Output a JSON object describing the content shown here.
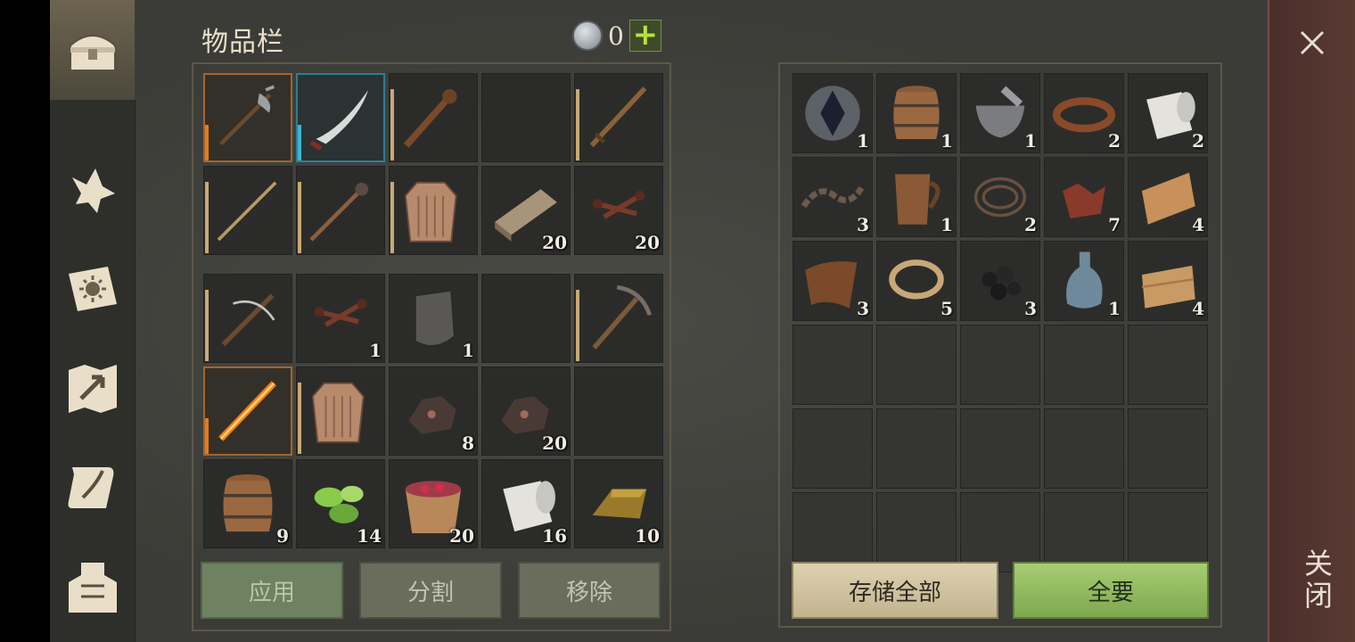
{
  "inventory": {
    "title": "物品栏",
    "coins": "0",
    "plus": "+"
  },
  "left_grid_top": [
    {
      "icon": "halberd-icon",
      "qty": "",
      "style": "orange"
    },
    {
      "icon": "scimitar-icon",
      "qty": "",
      "style": "blue"
    },
    {
      "icon": "spiked-club-icon",
      "qty": "",
      "style": ""
    },
    {
      "icon": "",
      "qty": "",
      "style": ""
    },
    {
      "icon": "sword-icon",
      "qty": "",
      "style": ""
    },
    {
      "icon": "spear-icon",
      "qty": "",
      "style": ""
    },
    {
      "icon": "mace-spear-icon",
      "qty": "",
      "style": ""
    },
    {
      "icon": "chainmail-icon",
      "qty": "",
      "style": ""
    },
    {
      "icon": "plank-icon",
      "qty": "20",
      "style": ""
    },
    {
      "icon": "nails-icon",
      "qty": "20",
      "style": ""
    }
  ],
  "left_grid_bottom": [
    {
      "icon": "crossbow-icon",
      "qty": "",
      "style": ""
    },
    {
      "icon": "nails-icon",
      "qty": "1",
      "style": ""
    },
    {
      "icon": "iron-plate-icon",
      "qty": "1",
      "style": ""
    },
    {
      "icon": "",
      "qty": "",
      "style": ""
    },
    {
      "icon": "pickaxe-icon",
      "qty": "",
      "style": ""
    },
    {
      "icon": "flame-sword-icon",
      "qty": "",
      "style": "orange"
    },
    {
      "icon": "chainmail-icon",
      "qty": "",
      "style": ""
    },
    {
      "icon": "ore-icon",
      "qty": "8",
      "style": ""
    },
    {
      "icon": "ore-icon",
      "qty": "20",
      "style": ""
    },
    {
      "icon": "",
      "qty": "",
      "style": ""
    },
    {
      "icon": "barrel-icon",
      "qty": "9",
      "style": ""
    },
    {
      "icon": "cactus-slices-icon",
      "qty": "14",
      "style": ""
    },
    {
      "icon": "berry-bucket-icon",
      "qty": "20",
      "style": ""
    },
    {
      "icon": "cloth-roll-icon",
      "qty": "16",
      "style": ""
    },
    {
      "icon": "ingot-icon",
      "qty": "10",
      "style": ""
    }
  ],
  "storage_grid": [
    {
      "icon": "crystal-icon",
      "qty": "1",
      "style": ""
    },
    {
      "icon": "barrel-icon",
      "qty": "1",
      "style": ""
    },
    {
      "icon": "mortar-icon",
      "qty": "1",
      "style": "sel"
    },
    {
      "icon": "leather-strap-icon",
      "qty": "2",
      "style": ""
    },
    {
      "icon": "cloth-roll-icon",
      "qty": "2",
      "style": ""
    },
    {
      "icon": "chain-icon",
      "qty": "3",
      "style": ""
    },
    {
      "icon": "mug-icon",
      "qty": "1",
      "style": ""
    },
    {
      "icon": "wire-icon",
      "qty": "2",
      "style": ""
    },
    {
      "icon": "scrap-icon",
      "qty": "7",
      "style": ""
    },
    {
      "icon": "fabric-icon",
      "qty": "4",
      "style": ""
    },
    {
      "icon": "leather-icon",
      "qty": "3",
      "style": ""
    },
    {
      "icon": "rope-icon",
      "qty": "5",
      "style": ""
    },
    {
      "icon": "coal-icon",
      "qty": "3",
      "style": ""
    },
    {
      "icon": "bottle-icon",
      "qty": "1",
      "style": ""
    },
    {
      "icon": "folded-cloth-icon",
      "qty": "4",
      "style": ""
    }
  ],
  "buttons": {
    "apply": "应用",
    "split": "分割",
    "remove": "移除",
    "store_all": "存储全部",
    "take_all": "全要"
  },
  "close": {
    "label": "关闭"
  },
  "colors": {
    "accent_green": "#8ab45b",
    "rarity_orange": "#e27c1d",
    "rarity_blue": "#3eb6d4"
  }
}
